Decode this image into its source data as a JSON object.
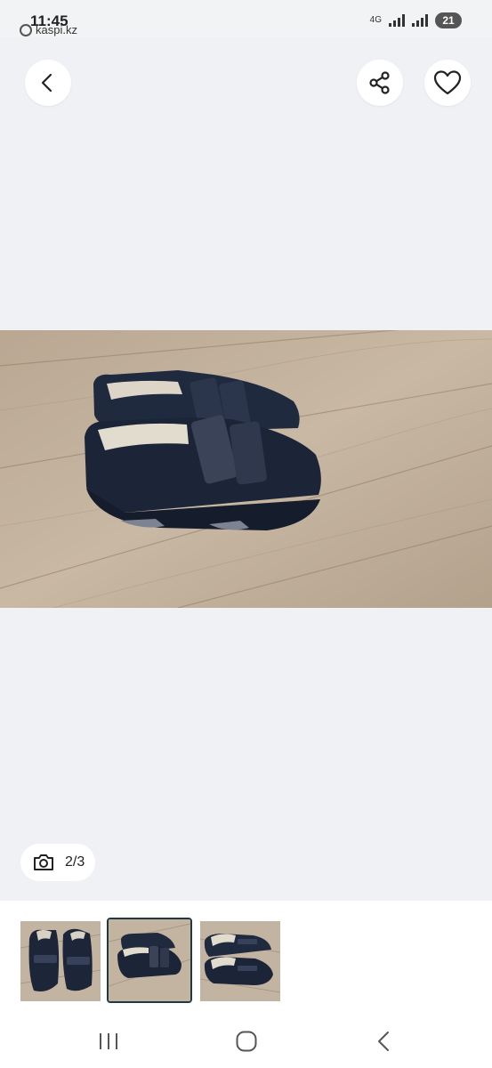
{
  "status": {
    "time": "11:45",
    "app": "kaspi.kz",
    "network": "4G",
    "battery": "21"
  },
  "header": {
    "back_icon": "chevron-left-icon",
    "share_icon": "share-icon",
    "favorite_icon": "heart-icon"
  },
  "gallery": {
    "counter": "2/3",
    "camera_icon": "camera-icon"
  },
  "thumbnails": [
    {
      "name": "thumbnail-1"
    },
    {
      "name": "thumbnail-2",
      "selected": true
    },
    {
      "name": "thumbnail-3"
    }
  ],
  "colors": {
    "background": "#f0f1f4",
    "selected_thumb_border": "#1f3b3f"
  }
}
